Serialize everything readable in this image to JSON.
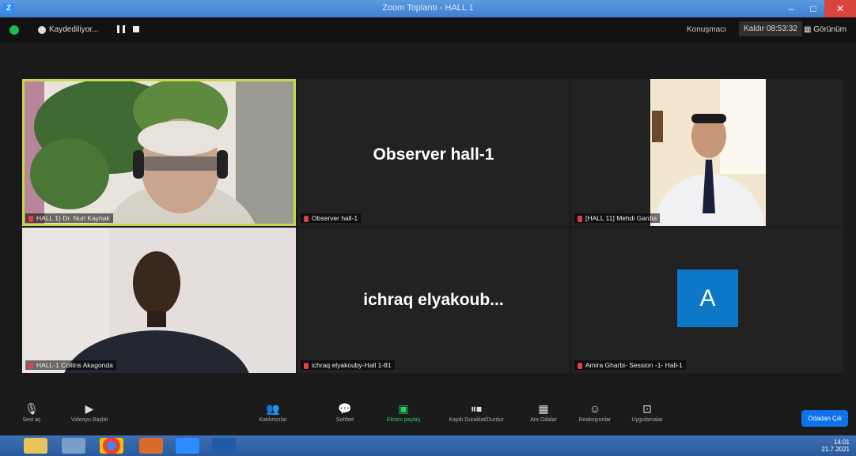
{
  "window": {
    "title": "Zoom Toplantı - HALL 1"
  },
  "topbar": {
    "recording_label": "Kaydediliyor...",
    "speaker_view": "Konuşmacı",
    "exit_fullscreen": "Kaldır 08:53:32",
    "gallery_view": "Görünüm"
  },
  "tiles": [
    {
      "caption": "HALL 1) Dr. Nuri Kaynak"
    },
    {
      "name": "Observer hall-1",
      "caption": "Observer hall-1"
    },
    {
      "caption": "[HALL 11] Mehdi Gardia"
    },
    {
      "caption": "HALL-1 Collins Akagonda"
    },
    {
      "name": "ichraq elyakoub...",
      "caption": "ichraq elyakouby-Hall 1-81"
    },
    {
      "avatar_letter": "A",
      "caption": "Amira Gharbi- Session -1- Hall-1"
    }
  ],
  "toolbar": {
    "items": [
      {
        "label": "Sesi aç",
        "icon": "mic-icon"
      },
      {
        "label": "Videoyu Başlat",
        "icon": "video-icon"
      },
      {
        "label": "Katılımcılar",
        "icon": "participants-icon"
      },
      {
        "label": "Sohbet",
        "icon": "chat-icon"
      },
      {
        "label": "Ekranı paylaş",
        "icon": "share-screen-icon"
      },
      {
        "label": "Kaydı Duraklat/Durdur",
        "icon": "record-icon"
      },
      {
        "label": "Ara Odalar",
        "icon": "breakout-rooms-icon"
      },
      {
        "label": "Reaksiyonlar",
        "icon": "reactions-icon"
      },
      {
        "label": "Uygulamalar",
        "icon": "apps-icon"
      }
    ],
    "breakout_button": "Odadan Çık",
    "accent": "#0e72ed",
    "share_color": "#2bd15a"
  },
  "taskbar": {
    "time": "14:01",
    "date": "21.7.2021"
  }
}
